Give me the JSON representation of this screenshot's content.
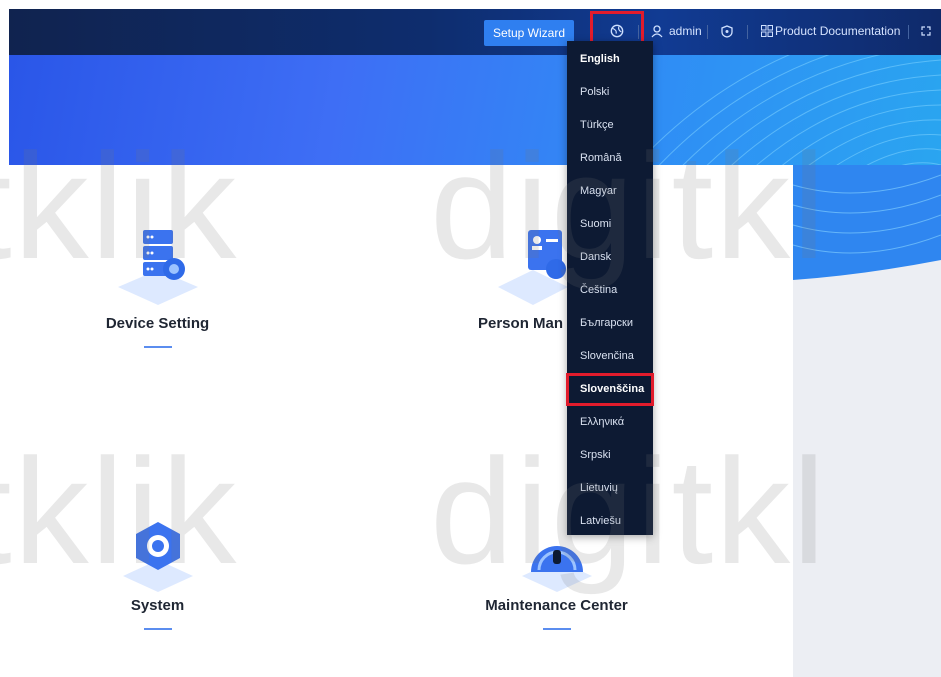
{
  "header": {
    "setup_wizard_label": "Setup Wizard",
    "user_label": "admin",
    "docs_label": "Product Documentation"
  },
  "cards": [
    {
      "title": "Device Setting"
    },
    {
      "title": "Person Man"
    },
    {
      "title": "System"
    },
    {
      "title": "Maintenance Center"
    }
  ],
  "language_menu": {
    "items": [
      "English",
      "Polski",
      "Türkçe",
      "Română",
      "Magyar",
      "Suomi",
      "Dansk",
      "Čeština",
      "Български",
      "Slovenčina",
      "Slovenščina",
      "Ελληνικά",
      "Srpski",
      "Lietuvių",
      "Latviešu"
    ],
    "selected": "English",
    "highlighted": "Slovenščina"
  },
  "watermark": {
    "text_left_top": "tklik",
    "text_right_top": "digitkl",
    "text_left_bottom": "tklik",
    "text_right_bottom": "digitkl"
  },
  "colors": {
    "header_bg": "#10234f",
    "accent": "#2f7ff0",
    "highlight_border": "#e21c2c",
    "dropdown_bg": "#0d1a33"
  },
  "icons": {
    "language": "globe-icon",
    "user": "user-icon",
    "shield": "shield-icon",
    "docs": "grid-icon",
    "fullscreen": "fullscreen-icon"
  }
}
